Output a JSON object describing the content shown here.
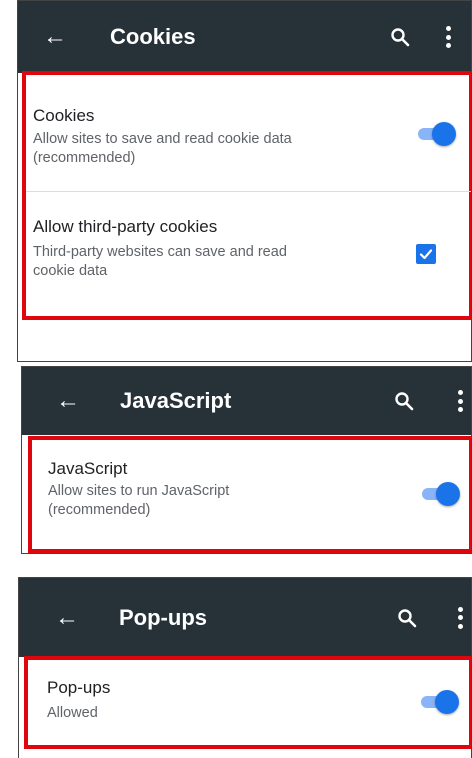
{
  "panels": {
    "cookies": {
      "title": "Cookies",
      "items": [
        {
          "title": "Cookies",
          "subtitle_line1": "Allow sites to save and read cookie data",
          "subtitle_line2": "(recommended)",
          "control": "toggle",
          "enabled": true
        },
        {
          "title": "Allow third-party cookies",
          "subtitle_line1": "Third-party websites can save and read",
          "subtitle_line2": "cookie data",
          "control": "checkbox",
          "checked": true
        }
      ]
    },
    "javascript": {
      "title": "JavaScript",
      "items": [
        {
          "title": "JavaScript",
          "subtitle_line1": "Allow sites to run JavaScript",
          "subtitle_line2": "(recommended)",
          "control": "toggle",
          "enabled": true
        }
      ]
    },
    "popups": {
      "title": "Pop-ups",
      "items": [
        {
          "title": "Pop-ups",
          "subtitle_line1": "Allowed",
          "control": "toggle",
          "enabled": true
        }
      ]
    }
  },
  "icons": {
    "back": "back-arrow-icon",
    "search": "search-icon",
    "more": "more-vert-icon",
    "check": "check-icon"
  },
  "colors": {
    "appbar": "#263238",
    "accent": "#1a73e8",
    "highlight": "#e0060e"
  }
}
